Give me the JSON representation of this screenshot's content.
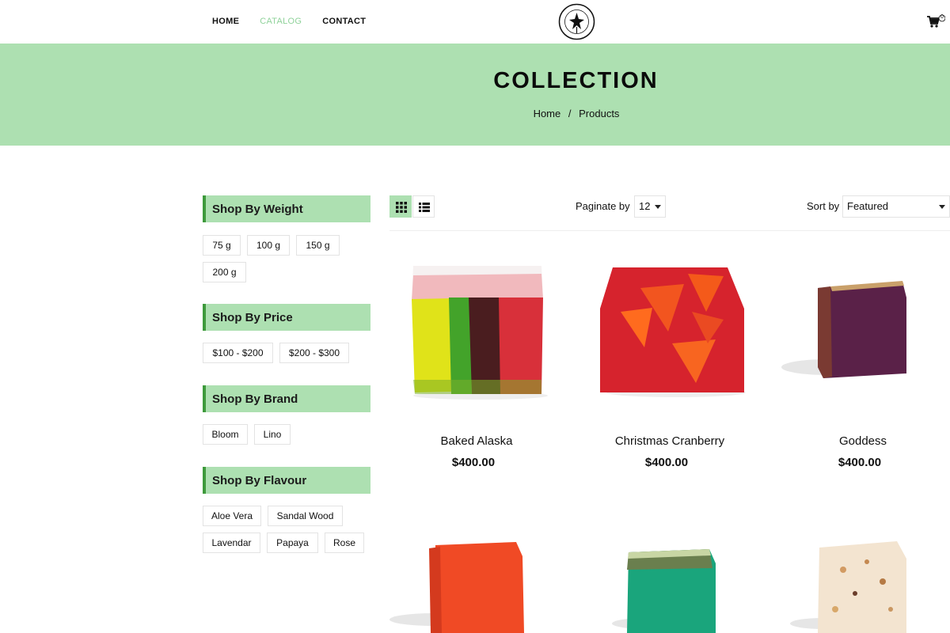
{
  "nav": {
    "items": [
      {
        "label": "HOME",
        "active": false
      },
      {
        "label": "CATALOG",
        "active": true
      },
      {
        "label": "CONTACT",
        "active": false
      }
    ]
  },
  "cart": {
    "count": "0",
    "icon": "cart-icon"
  },
  "logo": {
    "icon": "logo-emblem"
  },
  "banner": {
    "title": "COLLECTION",
    "breadcrumb": [
      "Home",
      "/",
      "Products"
    ]
  },
  "filters": {
    "weight": {
      "title": "Shop By Weight",
      "options": [
        "75 g",
        "100 g",
        "150 g",
        "200 g"
      ]
    },
    "price": {
      "title": "Shop By Price",
      "options": [
        "$100 - $200",
        "$200 - $300"
      ]
    },
    "brand": {
      "title": "Shop By Brand",
      "options": [
        "Bloom",
        "Lino"
      ]
    },
    "flavour": {
      "title": "Shop By Flavour",
      "options": [
        "Aloe Vera",
        "Sandal Wood",
        "Lavendar",
        "Papaya",
        "Rose"
      ]
    }
  },
  "toolbar": {
    "grid_icon": "grid-view-icon",
    "list_icon": "list-view-icon",
    "paginate_label": "Paginate by",
    "paginate_value": "12",
    "sort_label": "Sort by",
    "sort_value": "Featured"
  },
  "products": [
    {
      "name": "Baked Alaska",
      "price": "$400.00"
    },
    {
      "name": "Christmas Cranberry",
      "price": "$400.00"
    },
    {
      "name": "Goddess",
      "price": "$400.00"
    }
  ],
  "colors": {
    "accent": "#ade0b1",
    "accent_dark": "#3e9a3c",
    "nav_active": "#8fd29a"
  }
}
